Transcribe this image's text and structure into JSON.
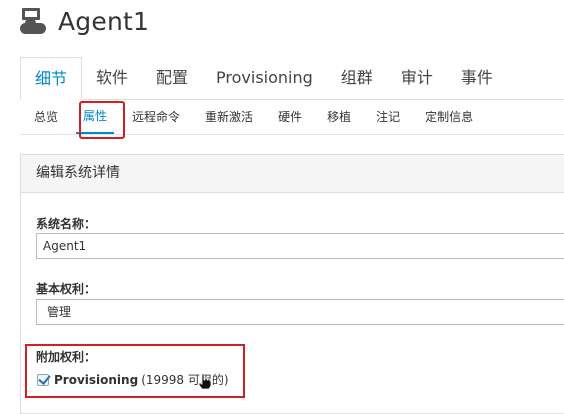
{
  "header": {
    "title": "Agent1",
    "icon": "system-icon"
  },
  "tabs": [
    {
      "label": "细节",
      "active": true
    },
    {
      "label": "软件"
    },
    {
      "label": "配置"
    },
    {
      "label": "Provisioning"
    },
    {
      "label": "组群"
    },
    {
      "label": "审计"
    },
    {
      "label": "事件"
    }
  ],
  "subtabs": [
    {
      "label": "总览"
    },
    {
      "label": "属性",
      "active": true
    },
    {
      "label": "远程命令"
    },
    {
      "label": "重新激活"
    },
    {
      "label": "硬件"
    },
    {
      "label": "移植"
    },
    {
      "label": "注记"
    },
    {
      "label": "定制信息"
    }
  ],
  "panel": {
    "title": "编辑系统详情"
  },
  "form": {
    "system_name_label": "系统名称：",
    "system_name_value": "Agent1",
    "base_entitlement_label": "基本权利：",
    "base_entitlement_value": "管理",
    "addon_label": "附加权利：",
    "addon_name": "Provisioning",
    "addon_count": "(19998 可用的)"
  },
  "colors": {
    "accent": "#0088ce",
    "highlight": "#d21f21"
  }
}
